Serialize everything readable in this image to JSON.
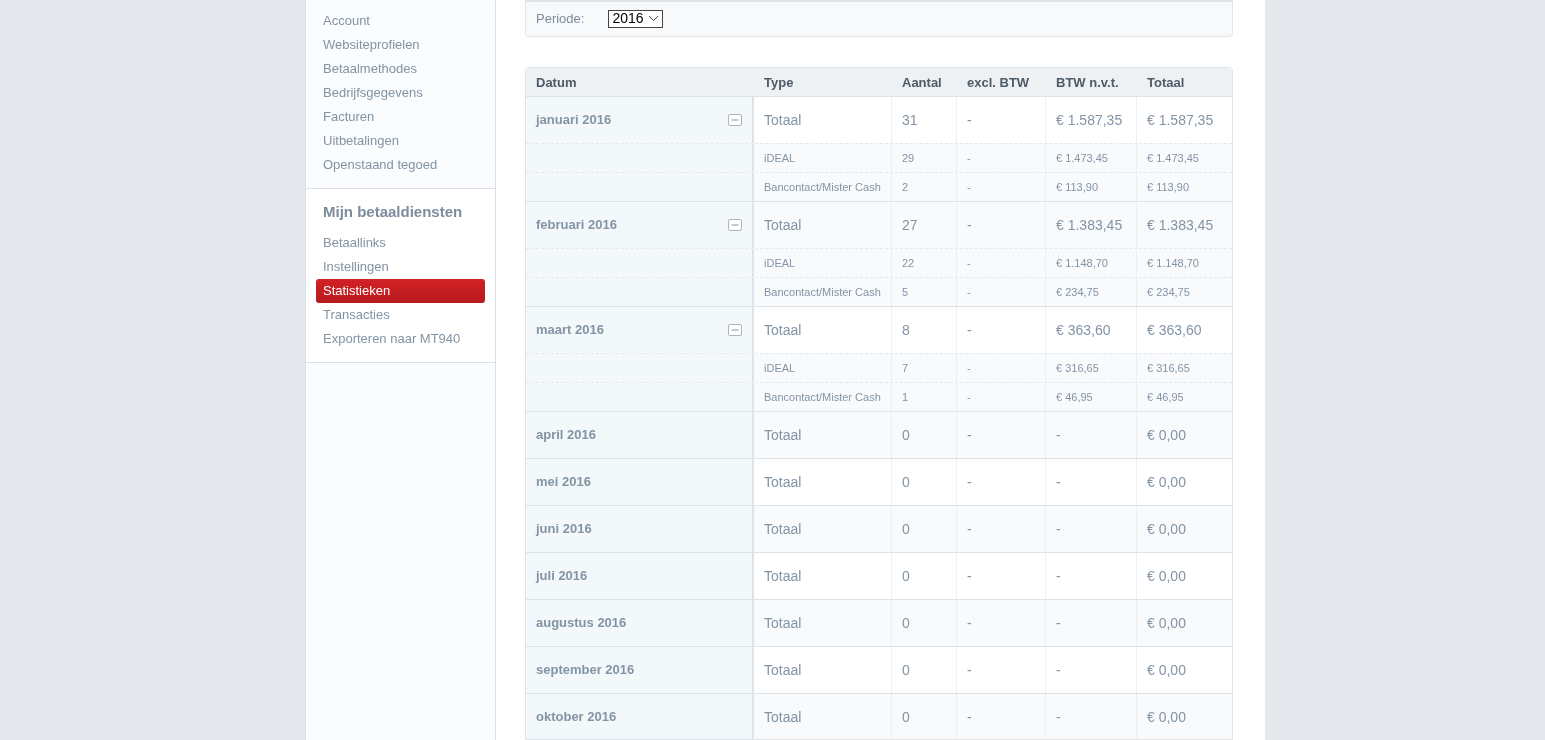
{
  "sidebar": {
    "items": [
      {
        "label": "Account",
        "selected": false
      },
      {
        "label": "Websiteprofielen",
        "selected": false
      },
      {
        "label": "Betaalmethodes",
        "selected": false
      },
      {
        "label": "Bedrijfsgegevens",
        "selected": false
      },
      {
        "label": "Facturen",
        "selected": false
      },
      {
        "label": "Uitbetalingen",
        "selected": false
      },
      {
        "label": "Openstaand tegoed",
        "selected": false
      }
    ],
    "section": {
      "title": "Mijn betaaldiensten",
      "items": [
        {
          "label": "Betaallinks",
          "selected": false
        },
        {
          "label": "Instellingen",
          "selected": false
        },
        {
          "label": "Statistieken",
          "selected": true
        },
        {
          "label": "Transacties",
          "selected": false
        },
        {
          "label": "Exporteren naar MT940",
          "selected": false
        }
      ]
    }
  },
  "filter": {
    "label": "Periode:",
    "value": "2016"
  },
  "table": {
    "columns": [
      "Datum",
      "Type",
      "Aantal",
      "excl. BTW",
      "BTW n.v.t.",
      "Totaal"
    ],
    "rows": [
      {
        "expanded": true,
        "cells": [
          "januari 2016",
          "Totaal",
          "31",
          "-",
          "€ 1.587,35",
          "€ 1.587,35"
        ],
        "details": [
          {
            "type": "iDEAL",
            "aantal": "29",
            "excl_btw": "-",
            "btw": "€ 1.473,45",
            "totaal": "€ 1.473,45"
          },
          {
            "type": "Bancontact/Mister Cash",
            "aantal": "2",
            "excl_btw": "-",
            "btw": "€ 113,90",
            "totaal": "€ 113,90"
          }
        ]
      },
      {
        "expanded": true,
        "cells": [
          "februari 2016",
          "Totaal",
          "27",
          "-",
          "€ 1.383,45",
          "€ 1.383,45"
        ],
        "details": [
          {
            "type": "iDEAL",
            "aantal": "22",
            "excl_btw": "-",
            "btw": "€ 1.148,70",
            "totaal": "€ 1.148,70"
          },
          {
            "type": "Bancontact/Mister Cash",
            "aantal": "5",
            "excl_btw": "-",
            "btw": "€ 234,75",
            "totaal": "€ 234,75"
          }
        ]
      },
      {
        "expanded": true,
        "cells": [
          "maart 2016",
          "Totaal",
          "8",
          "-",
          "€ 363,60",
          "€ 363,60"
        ],
        "details": [
          {
            "type": "iDEAL",
            "aantal": "7",
            "excl_btw": "-",
            "btw": "€ 316,65",
            "totaal": "€ 316,65"
          },
          {
            "type": "Bancontact/Mister Cash",
            "aantal": "1",
            "excl_btw": "-",
            "btw": "€ 46,95",
            "totaal": "€ 46,95"
          }
        ]
      },
      {
        "cells": [
          "april 2016",
          "Totaal",
          "0",
          "-",
          "-",
          "€ 0,00"
        ]
      },
      {
        "cells": [
          "mei 2016",
          "Totaal",
          "0",
          "-",
          "-",
          "€ 0,00"
        ]
      },
      {
        "cells": [
          "juni 2016",
          "Totaal",
          "0",
          "-",
          "-",
          "€ 0,00"
        ]
      },
      {
        "cells": [
          "juli 2016",
          "Totaal",
          "0",
          "-",
          "-",
          "€ 0,00"
        ]
      },
      {
        "cells": [
          "augustus 2016",
          "Totaal",
          "0",
          "-",
          "-",
          "€ 0,00"
        ]
      },
      {
        "cells": [
          "september 2016",
          "Totaal",
          "0",
          "-",
          "-",
          "€ 0,00"
        ]
      },
      {
        "cells": [
          "oktober 2016",
          "Totaal",
          "0",
          "-",
          "-",
          "€ 0,00"
        ]
      }
    ]
  }
}
